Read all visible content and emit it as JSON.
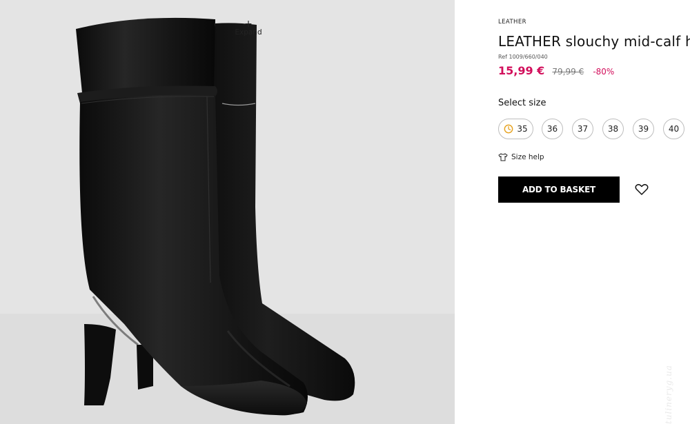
{
  "gallery": {
    "expand_label": "Expand",
    "expand_icon": "plus-icon",
    "image_alt": "black leather slouchy mid-calf heeled boots"
  },
  "product": {
    "category": "LEATHER",
    "title": "LEATHER slouchy mid-calf heel",
    "ref": "Ref 1009/660/040",
    "price_now": "15,99 €",
    "price_old": "79,99 €",
    "discount": "-80%",
    "price_color": "#d20e5b"
  },
  "size_selector": {
    "label": "Select size",
    "sizes": [
      {
        "label": "35",
        "low_stock": true
      },
      {
        "label": "36",
        "low_stock": false
      },
      {
        "label": "37",
        "low_stock": false
      },
      {
        "label": "38",
        "low_stock": false
      },
      {
        "label": "39",
        "low_stock": false
      },
      {
        "label": "40",
        "low_stock": false
      }
    ]
  },
  "size_help": {
    "label": "Size help",
    "icon": "shirt-icon"
  },
  "actions": {
    "add_to_basket": "ADD TO BASKET",
    "wishlist_icon": "heart-icon"
  },
  "watermark": "tulineryg.ua"
}
